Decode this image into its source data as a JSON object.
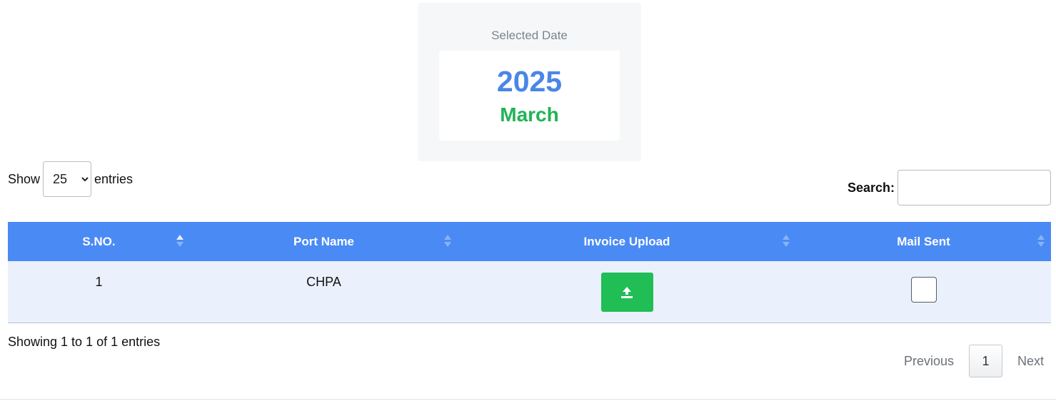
{
  "selected_date": {
    "label": "Selected Date",
    "year": "2025",
    "month": "March"
  },
  "length_menu": {
    "show_label": "Show",
    "selected": "25",
    "entries_label": "entries"
  },
  "search": {
    "label": "Search:",
    "value": "",
    "placeholder": ""
  },
  "table": {
    "columns": [
      "S.NO.",
      "Port Name",
      "Invoice Upload",
      "Mail Sent"
    ],
    "rows": [
      {
        "sno": "1",
        "port_name": "CHPA",
        "invoice_upload": "upload-icon",
        "mail_sent": false
      }
    ]
  },
  "info": "Showing 1 to 1 of 1 entries",
  "pagination": {
    "previous": "Previous",
    "current_page": "1",
    "next": "Next"
  },
  "colors": {
    "header_bg": "#4a8af5",
    "row_bg": "#eaf1fd",
    "year": "#4a86e8",
    "month": "#20b454",
    "upload_button": "#20be55"
  }
}
